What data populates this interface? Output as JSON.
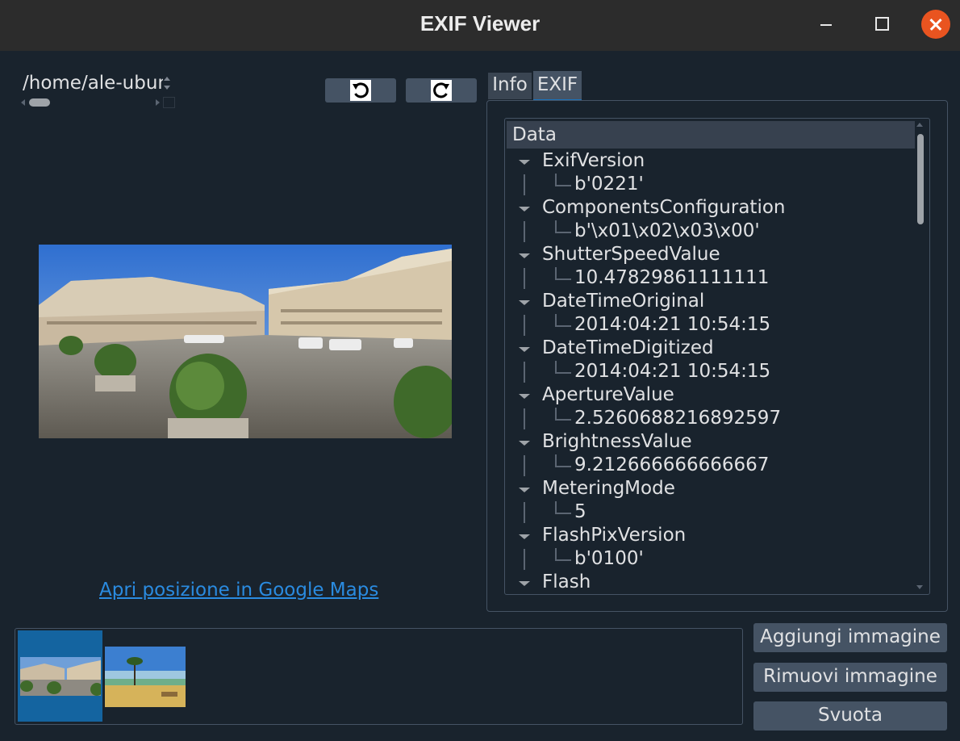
{
  "window": {
    "title": "EXIF Viewer"
  },
  "path": {
    "value": "/home/ale-ubuntu"
  },
  "tabs": [
    {
      "label": "Info"
    },
    {
      "label": "EXIF"
    }
  ],
  "tree": {
    "header": "Data",
    "rows": [
      {
        "key": "ExifVersion",
        "value": "b'0221'"
      },
      {
        "key": "ComponentsConfiguration",
        "value": "b'\\x01\\x02\\x03\\x00'"
      },
      {
        "key": "ShutterSpeedValue",
        "value": "10.47829861111111"
      },
      {
        "key": "DateTimeOriginal",
        "value": "2014:04:21 10:54:15"
      },
      {
        "key": "DateTimeDigitized",
        "value": "2014:04:21 10:54:15"
      },
      {
        "key": "ApertureValue",
        "value": "2.5260688216892597"
      },
      {
        "key": "BrightnessValue",
        "value": "9.212666666666667"
      },
      {
        "key": "MeteringMode",
        "value": "5"
      },
      {
        "key": "FlashPixVersion",
        "value": "b'0100'"
      },
      {
        "key": "Flash",
        "value": ""
      }
    ]
  },
  "links": {
    "maps": "Apri posizione in Google Maps"
  },
  "buttons": {
    "add": "Aggiungi immagine",
    "remove": "Rimuovi immagine",
    "clear": "Svuota"
  },
  "icons": {
    "rotate_left": "rotate-left-icon",
    "rotate_right": "rotate-right-icon"
  },
  "colors": {
    "background": "#19232d",
    "button": "#455364",
    "accent": "#1464a0",
    "link": "#2a8be0",
    "close": "#e95420"
  }
}
